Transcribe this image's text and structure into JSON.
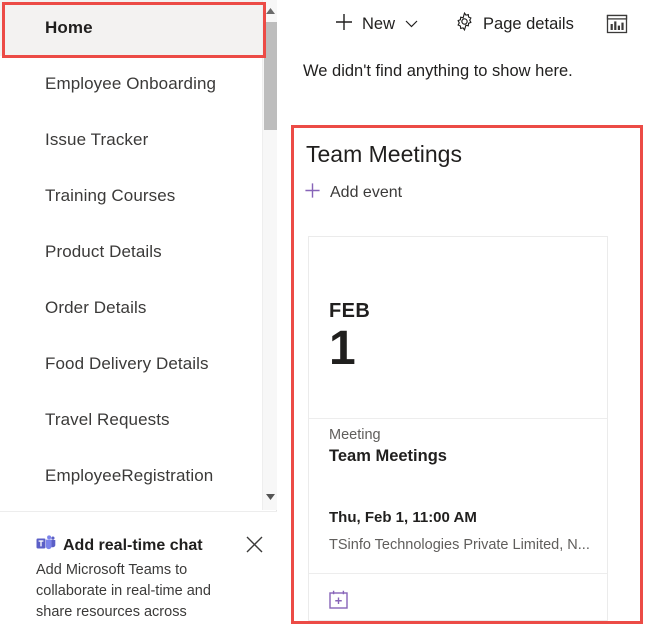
{
  "sidebar": {
    "items": [
      {
        "label": "Home",
        "selected": true
      },
      {
        "label": "Employee Onboarding",
        "selected": false
      },
      {
        "label": "Issue Tracker",
        "selected": false
      },
      {
        "label": "Training Courses",
        "selected": false
      },
      {
        "label": "Product Details",
        "selected": false
      },
      {
        "label": "Order Details",
        "selected": false
      },
      {
        "label": "Food Delivery Details",
        "selected": false
      },
      {
        "label": "Travel Requests",
        "selected": false
      },
      {
        "label": "EmployeeRegistration",
        "selected": false
      }
    ],
    "scrollbar": {
      "up_arrow_icon": "chevron-up-icon",
      "down_arrow_icon": "chevron-down-icon"
    }
  },
  "teams_promo": {
    "icon": "microsoft-teams-icon",
    "title": "Add real-time chat",
    "body": "Add Microsoft Teams to collaborate in real-time and share resources across",
    "close_icon": "close-icon"
  },
  "command_bar": {
    "new_label": "New",
    "new_icon": "plus-icon",
    "new_chevron_icon": "chevron-down-icon",
    "page_details_label": "Page details",
    "page_details_icon": "gear-icon",
    "analytics_icon": "bar-chart-icon"
  },
  "content": {
    "empty_message": "We didn't find anything to show here."
  },
  "events_webpart": {
    "title": "Team Meetings",
    "add_event_label": "Add event",
    "add_event_icon": "plus-icon",
    "event": {
      "month": "FEB",
      "day": "1",
      "kind": "Meeting",
      "name": "Team Meetings",
      "datetime": "Thu, Feb 1, 11:00 AM",
      "location": "TSinfo Technologies Private Limited, N...",
      "add_to_calendar_icon": "calendar-add-icon"
    }
  },
  "colors": {
    "annotation": "#ec4b46",
    "accent_purple": "#8764b8",
    "teams_purple": "#5b5fc7",
    "selected_nav_bg": "#f3f2f1"
  }
}
